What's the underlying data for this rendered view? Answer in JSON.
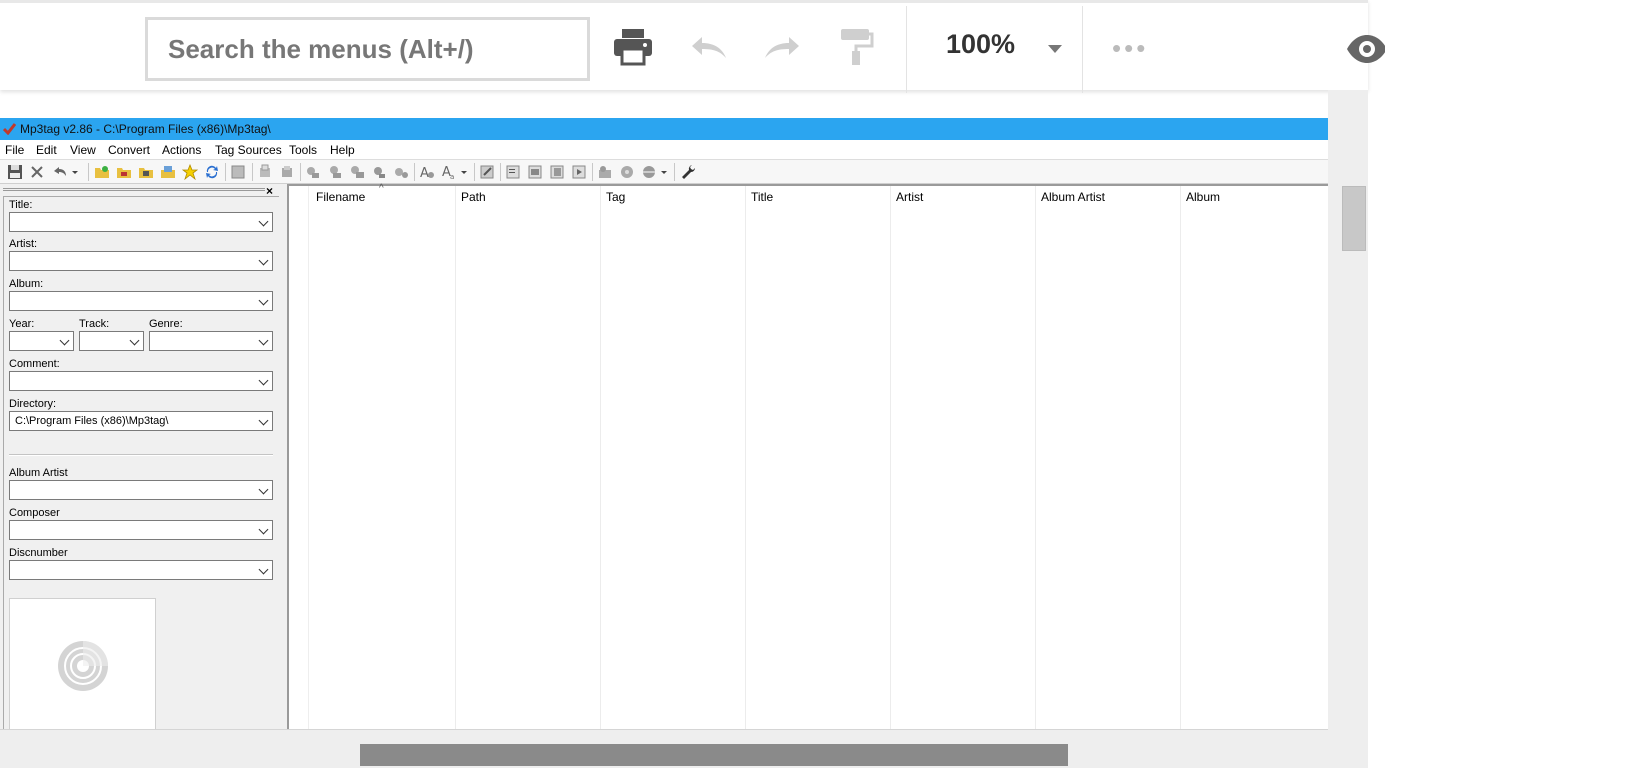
{
  "toolbar": {
    "search_placeholder": "Search the menus (Alt+/)",
    "zoom": "100%",
    "more": "•••"
  },
  "window": {
    "title": "Mp3tag v2.86  -  C:\\Program Files (x86)\\Mp3tag\\",
    "titlebar_color": "#2ba5f0"
  },
  "menu": {
    "items": [
      "File",
      "Edit",
      "View",
      "Convert",
      "Actions",
      "Tag Sources",
      "Tools",
      "Help"
    ]
  },
  "tag_panel": {
    "close": "×",
    "title_label": "Title:",
    "artist_label": "Artist:",
    "album_label": "Album:",
    "year_label": "Year:",
    "track_label": "Track:",
    "genre_label": "Genre:",
    "comment_label": "Comment:",
    "directory_label": "Directory:",
    "directory_value": "C:\\Program Files (x86)\\Mp3tag\\",
    "album_artist_label": "Album Artist",
    "composer_label": "Composer",
    "discnumber_label": "Discnumber"
  },
  "file_list": {
    "columns": [
      "Filename",
      "Path",
      "Tag",
      "Title",
      "Artist",
      "Album Artist",
      "Album"
    ],
    "sort_indicator": "^"
  }
}
